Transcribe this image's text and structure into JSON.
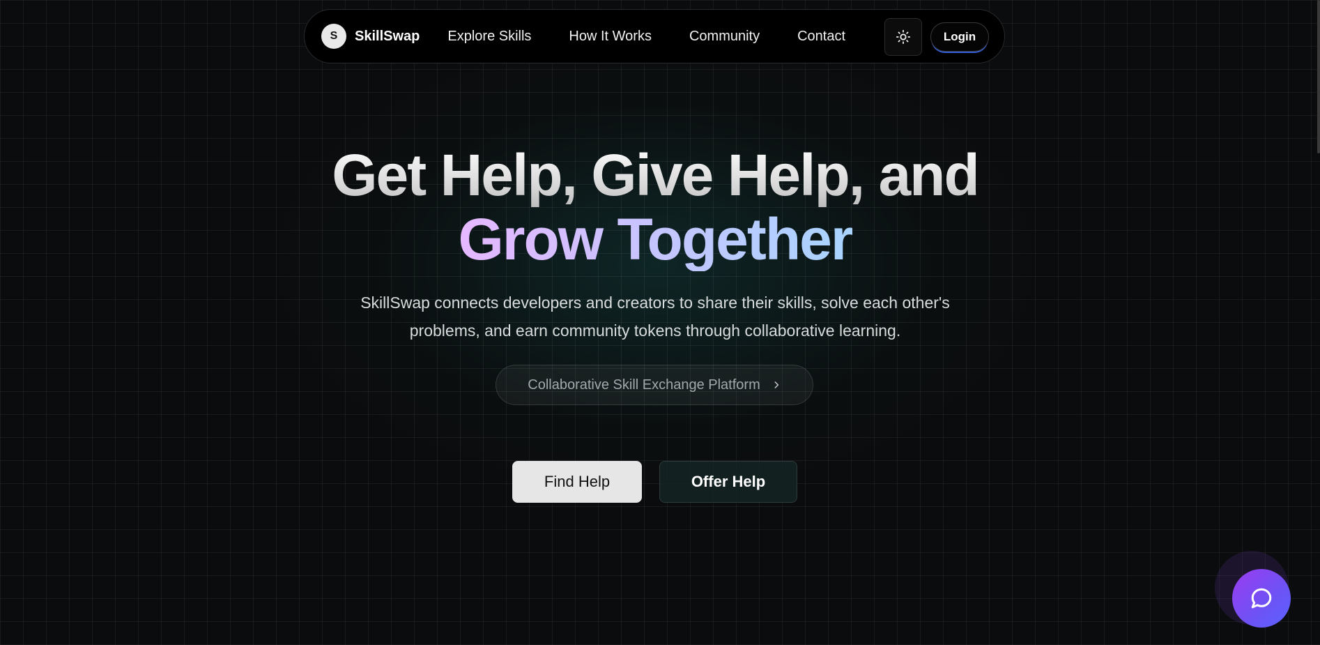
{
  "nav": {
    "logo_letter": "S",
    "brand": "SkillSwap",
    "links": [
      "Explore Skills",
      "How It Works",
      "Community",
      "Contact"
    ],
    "theme_toggle_icon": "sun-icon",
    "login_label": "Login"
  },
  "hero": {
    "title_line1": "Get Help, Give Help, and",
    "title_line2": "Grow Together",
    "subtitle_line1": "SkillSwap connects developers and creators to share their skills, solve each other's",
    "subtitle_line2": "problems, and earn community tokens through collaborative learning.",
    "pill_label": "Collaborative Skill Exchange Platform",
    "pill_icon": "chevron-right-icon",
    "find_help_label": "Find Help",
    "offer_help_label": "Offer Help"
  },
  "chat": {
    "icon": "chat-bubble-icon"
  },
  "colors": {
    "background": "#0b0c0d",
    "accent_gradient_start": "#9b3df0",
    "accent_gradient_end": "#5a63ff",
    "title_gradient_start": "#e6b8ff",
    "title_gradient_end": "#a8d4ff"
  }
}
